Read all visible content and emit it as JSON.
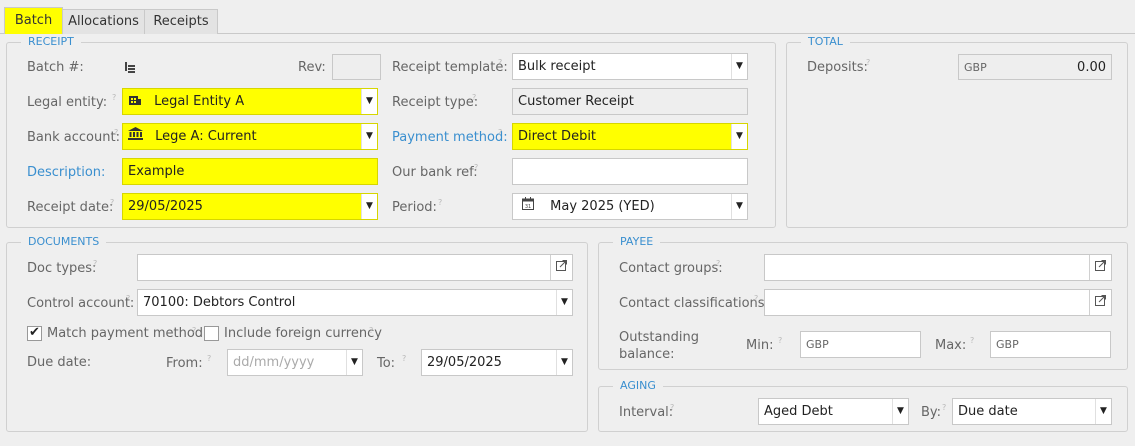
{
  "tabs": [
    {
      "label": "Batch",
      "active": true
    },
    {
      "label": "Allocations",
      "active": false
    },
    {
      "label": "Receipts",
      "active": false
    }
  ],
  "receipt": {
    "legend": "RECEIPT",
    "batch_label": "Batch #:",
    "rev_label": "Rev:",
    "rev_value": "",
    "receipt_template_label": "Receipt template:",
    "receipt_template_value": "Bulk receipt",
    "legal_entity_label": "Legal entity:",
    "legal_entity_value": "Legal Entity A",
    "receipt_type_label": "Receipt type:",
    "receipt_type_value": "Customer Receipt",
    "bank_account_label": "Bank account:",
    "bank_account_value": "Lege A: Current",
    "payment_method_label": "Payment method:",
    "payment_method_value": "Direct Debit",
    "description_label": "Description:",
    "description_value": "Example",
    "our_bank_ref_label": "Our bank ref:",
    "our_bank_ref_value": "",
    "receipt_date_label": "Receipt date:",
    "receipt_date_value": "29/05/2025",
    "period_label": "Period:",
    "period_value": "May 2025 (YED)"
  },
  "total": {
    "legend": "TOTAL",
    "deposits_label": "Deposits:",
    "currency": "GBP",
    "deposits_value": "0.00"
  },
  "documents": {
    "legend": "DOCUMENTS",
    "doc_types_label": "Doc types:",
    "doc_types_value": "",
    "control_account_label": "Control account:",
    "control_account_value": "70100: Debtors Control",
    "match_payment_label": "Match payment method",
    "match_payment_checked": true,
    "include_foreign_label": "Include foreign currency",
    "include_foreign_checked": false,
    "due_date_label": "Due date:",
    "from_label": "From:",
    "from_placeholder": "dd/mm/yyyy",
    "to_label": "To:",
    "to_value": "29/05/2025"
  },
  "payee": {
    "legend": "PAYEE",
    "contact_groups_label": "Contact groups:",
    "contact_classifications_label": "Contact classifications:",
    "outstanding_label_1": "Outstanding",
    "outstanding_label_2": "balance:",
    "min_label": "Min:",
    "min_currency": "GBP",
    "max_label": "Max:",
    "max_currency": "GBP"
  },
  "aging": {
    "legend": "AGING",
    "interval_label": "Interval:",
    "interval_value": "Aged Debt",
    "by_label": "By:",
    "by_value": "Due date"
  },
  "colors": {
    "highlight": "#ffff00",
    "link_label": "#3a8fcf",
    "legend": "#3a8fcf"
  },
  "glyphs": {
    "help": "?",
    "dropdown": "▼",
    "check": "✔"
  }
}
